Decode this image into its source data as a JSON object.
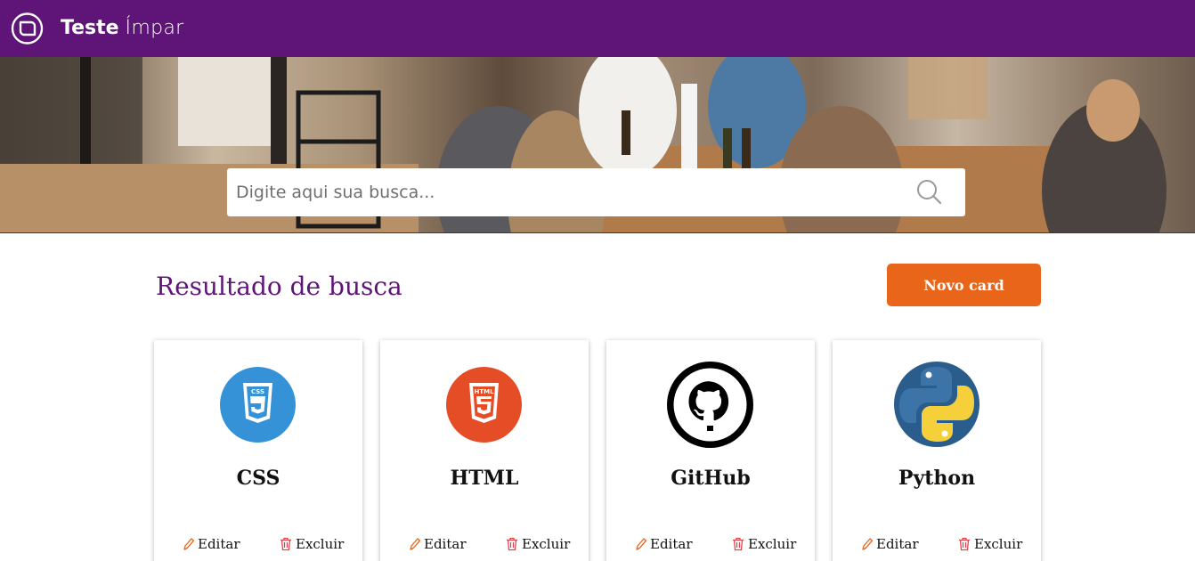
{
  "header": {
    "brand_bold": "Teste",
    "brand_light": "Ímpar"
  },
  "search": {
    "placeholder": "Digite aqui sua busca..."
  },
  "results": {
    "title": "Resultado de busca",
    "new_card_label": "Novo card"
  },
  "cards": [
    {
      "title": "CSS",
      "icon": "css3-icon",
      "edit_label": "Editar",
      "delete_label": "Excluir"
    },
    {
      "title": "HTML",
      "icon": "html5-icon",
      "edit_label": "Editar",
      "delete_label": "Excluir"
    },
    {
      "title": "GitHub",
      "icon": "github-icon",
      "edit_label": "Editar",
      "delete_label": "Excluir"
    },
    {
      "title": "Python",
      "icon": "python-icon",
      "edit_label": "Editar",
      "delete_label": "Excluir"
    }
  ],
  "colors": {
    "brand_purple": "#5f1478",
    "accent_orange": "#e8651a",
    "css_blue": "#3592d6",
    "html_orange": "#e44d26",
    "python_blue": "#3c74a8",
    "python_yellow": "#f5d03a",
    "icon_edit": "#e8651a",
    "icon_delete": "#e0454f"
  }
}
